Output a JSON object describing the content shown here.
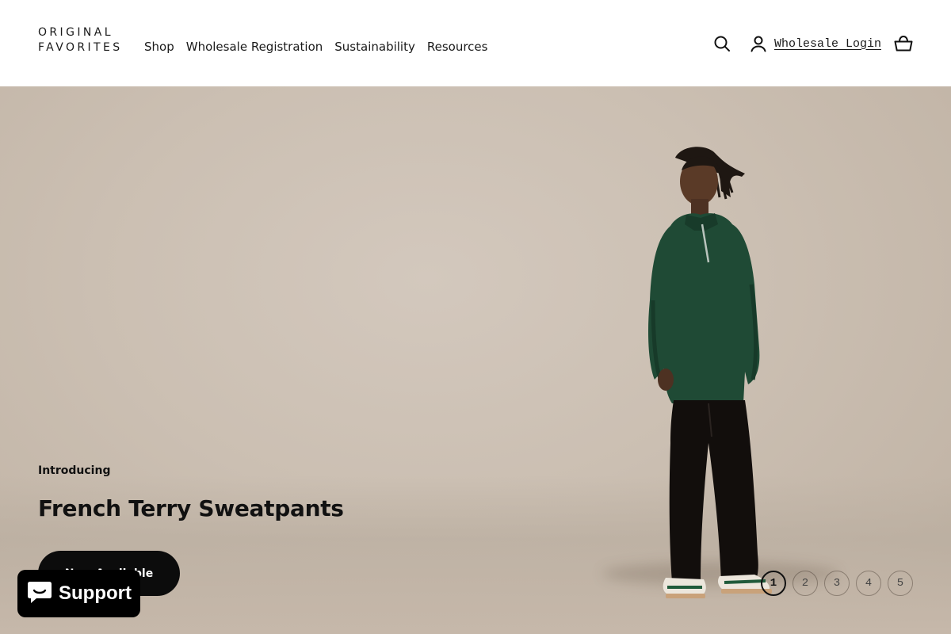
{
  "brand": {
    "line1": "ORIGINAL",
    "line2": "FAVORITES"
  },
  "nav": {
    "items": [
      {
        "label": "Shop"
      },
      {
        "label": "Wholesale Registration"
      },
      {
        "label": "Sustainability"
      },
      {
        "label": "Resources"
      }
    ]
  },
  "header_actions": {
    "search_icon": "search-icon",
    "account_icon": "account-icon",
    "login_label": "Wholesale Login",
    "cart_icon": "cart-icon"
  },
  "hero": {
    "eyebrow": "Introducing",
    "title": "French Terry Sweatpants",
    "cta_label": "Now Available",
    "slides": [
      "1",
      "2",
      "3",
      "4",
      "5"
    ],
    "active_slide": "1"
  },
  "support_chat": {
    "label": "Support",
    "icon": "chat-bubble-icon"
  },
  "colors": {
    "cta_bg": "#0c0c0c",
    "hero_bg": "#cbbfb2",
    "sweater": "#1f4a35"
  }
}
